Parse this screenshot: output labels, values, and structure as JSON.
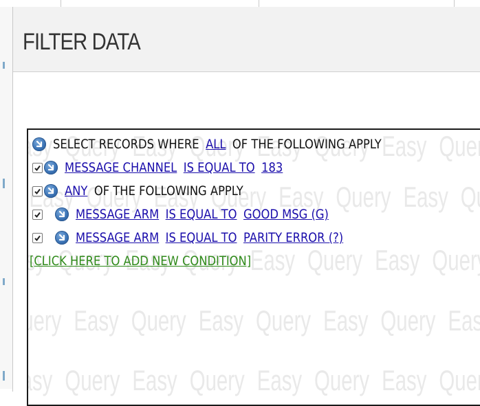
{
  "dialog": {
    "title": "FILTER DATA"
  },
  "watermark": {
    "text": "Easy Query"
  },
  "filter": {
    "root": {
      "prefix": "SELECT RECORDS WHERE",
      "mode_link": "ALL",
      "suffix": "OF THE FOLLOWING APPLY"
    },
    "conditions": [
      {
        "checked": true,
        "field": "MESSAGE CHANNEL",
        "operator": "IS EQUAL TO",
        "value": "183"
      }
    ],
    "group": {
      "checked": true,
      "mode_link": "ANY",
      "suffix": "OF THE FOLLOWING APPLY",
      "conditions": [
        {
          "checked": true,
          "field": "MESSAGE ARM",
          "operator": "IS EQUAL TO",
          "value": "GOOD MSG (G)"
        },
        {
          "checked": true,
          "field": "MESSAGE ARM",
          "operator": "IS EQUAL TO",
          "value": "PARITY ERROR (?)"
        }
      ]
    },
    "add_condition": "[CLICK HERE TO ADD NEW CONDITION]"
  },
  "colors": {
    "link": "#1a0dab",
    "add_link": "#2f8a1a",
    "orb": "#3c74b6",
    "header_bg": "#f2f2f2"
  }
}
